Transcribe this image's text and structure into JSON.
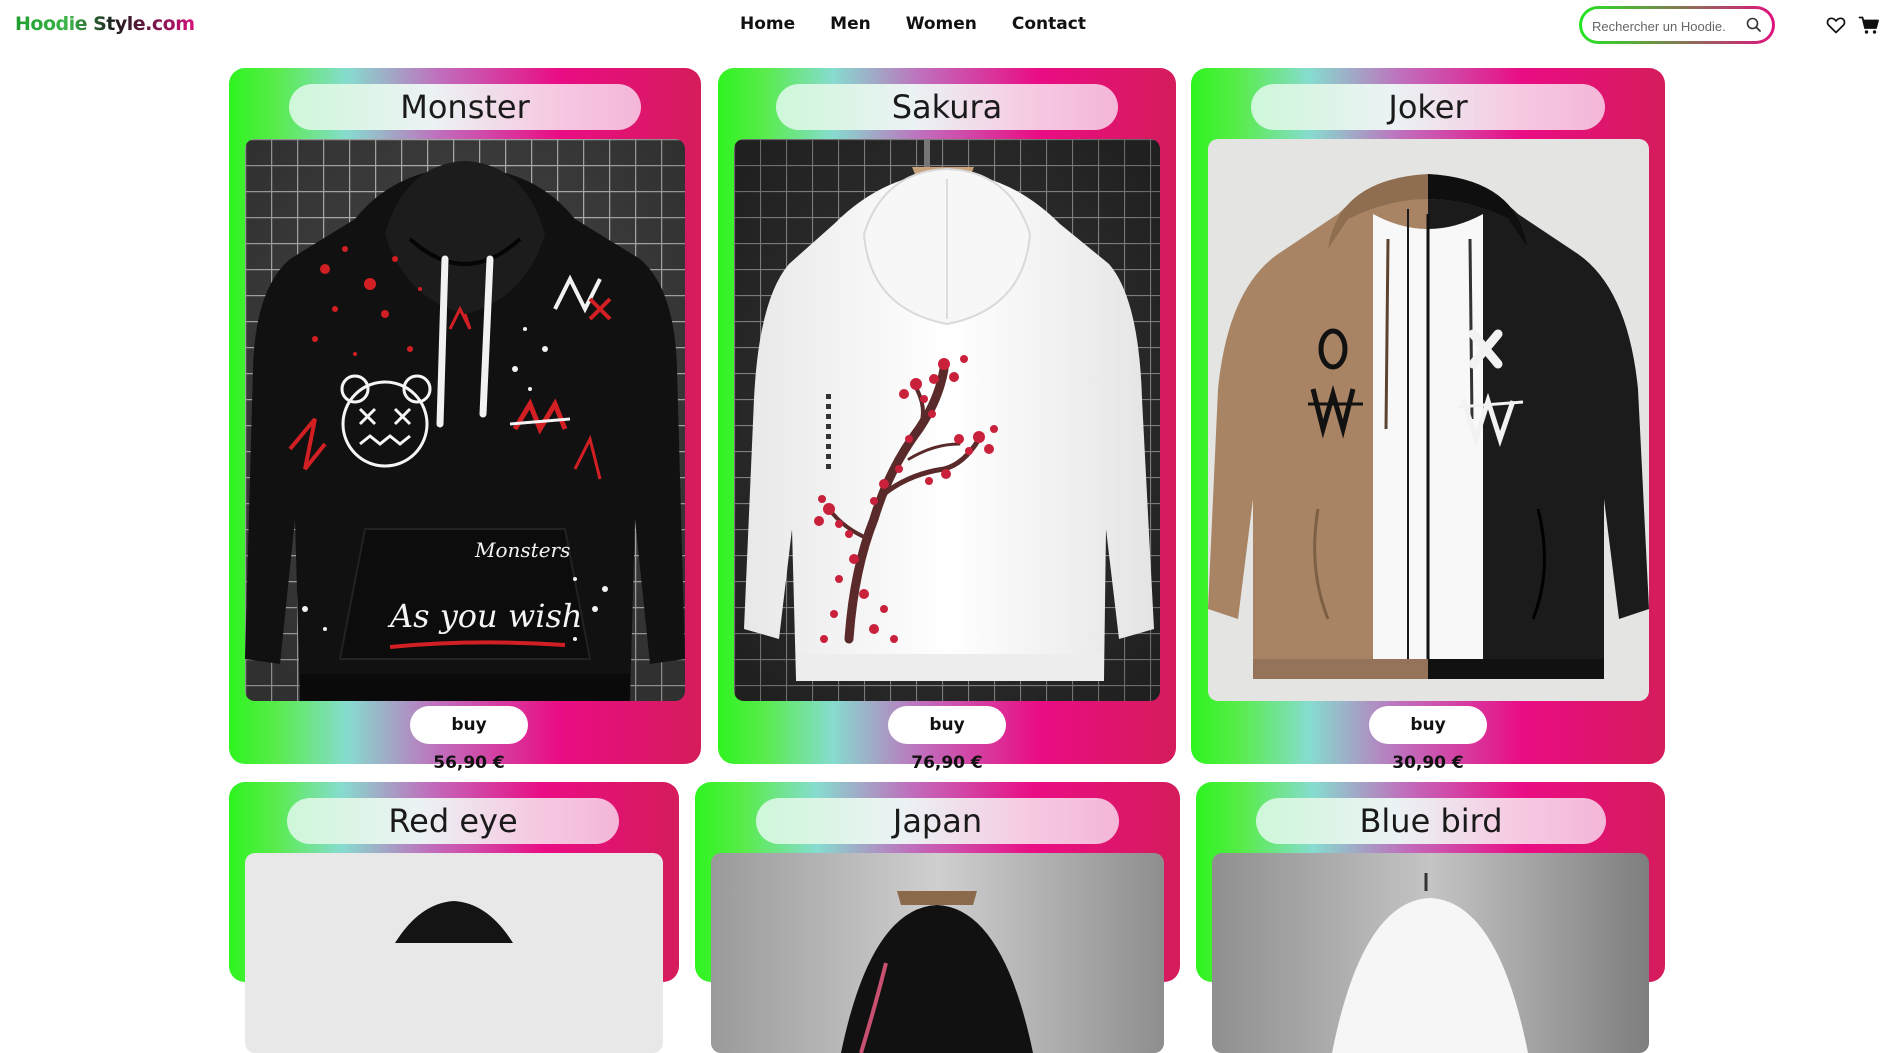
{
  "header": {
    "logo": "Hoodie Style.com",
    "nav": [
      "Home",
      "Men",
      "Women",
      "Contact"
    ],
    "search_placeholder": "Rechercher un Hoodie.",
    "icons": [
      "heart-icon",
      "cart-icon",
      "search-icon"
    ]
  },
  "colors": {
    "card_gradient_start": "#2ef41f",
    "card_gradient_mid": "#86dccf",
    "card_gradient_end": "#ea0c84",
    "search_border_start": "#22e622",
    "search_border_end": "#e0127f"
  },
  "products": [
    {
      "name": "Monster",
      "buy": "buy 56,90 €",
      "hoodie": "black graffiti hoodie"
    },
    {
      "name": "Sakura",
      "buy": "buy 76,90 €",
      "hoodie": "white hoodie with cherry blossom print"
    },
    {
      "name": "Joker",
      "buy": "buy 30,90 €",
      "hoodie": "brown and black split zip hoodie"
    },
    {
      "name": "Red eye",
      "hoodie": "black hoodie"
    },
    {
      "name": "Japan",
      "hoodie": "black hoodie"
    },
    {
      "name": "Blue bird",
      "hoodie": "white hoodie"
    }
  ],
  "print_text": {
    "monster_line1": "Monsters",
    "monster_line2": "As you wish"
  }
}
